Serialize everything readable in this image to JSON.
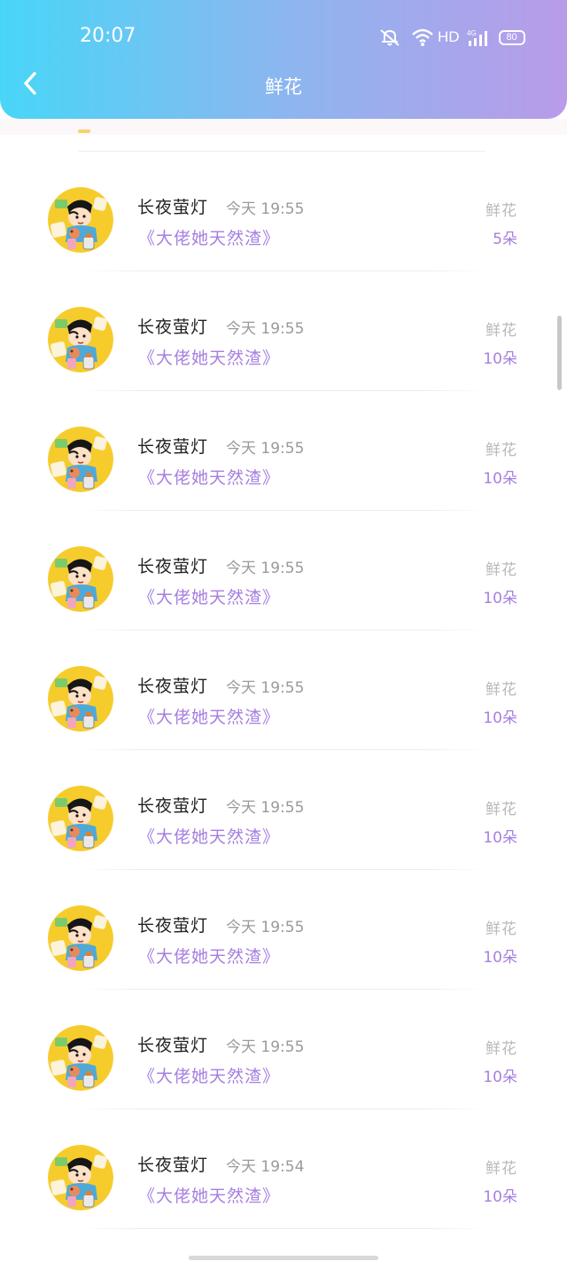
{
  "status_bar": {
    "time": "20:07",
    "network": "HD",
    "battery": "80"
  },
  "header": {
    "title": "鲜花"
  },
  "items": [
    {
      "user": "长夜萤灯",
      "time": "今天 19:55",
      "book": "《大佬她天然渣》",
      "gift": "鲜花",
      "count": "5朵"
    },
    {
      "user": "长夜萤灯",
      "time": "今天 19:55",
      "book": "《大佬她天然渣》",
      "gift": "鲜花",
      "count": "10朵"
    },
    {
      "user": "长夜萤灯",
      "time": "今天 19:55",
      "book": "《大佬她天然渣》",
      "gift": "鲜花",
      "count": "10朵"
    },
    {
      "user": "长夜萤灯",
      "time": "今天 19:55",
      "book": "《大佬她天然渣》",
      "gift": "鲜花",
      "count": "10朵"
    },
    {
      "user": "长夜萤灯",
      "time": "今天 19:55",
      "book": "《大佬她天然渣》",
      "gift": "鲜花",
      "count": "10朵"
    },
    {
      "user": "长夜萤灯",
      "time": "今天 19:55",
      "book": "《大佬她天然渣》",
      "gift": "鲜花",
      "count": "10朵"
    },
    {
      "user": "长夜萤灯",
      "time": "今天 19:55",
      "book": "《大佬她天然渣》",
      "gift": "鲜花",
      "count": "10朵"
    },
    {
      "user": "长夜萤灯",
      "time": "今天 19:55",
      "book": "《大佬她天然渣》",
      "gift": "鲜花",
      "count": "10朵"
    },
    {
      "user": "长夜萤灯",
      "time": "今天 19:54",
      "book": "《大佬她天然渣》",
      "gift": "鲜花",
      "count": "10朵"
    }
  ],
  "icons": {
    "back": "chevron-left-icon",
    "mute": "bell-off-icon",
    "wifi": "wifi-icon",
    "signal": "signal-4g-icon",
    "avatar": "cartoon-avatar"
  },
  "colors": {
    "header_start": "#48d6f7",
    "header_end": "#b99be9",
    "accent_purple": "#a67fe0",
    "avatar_bg": "#f6cc2c"
  }
}
